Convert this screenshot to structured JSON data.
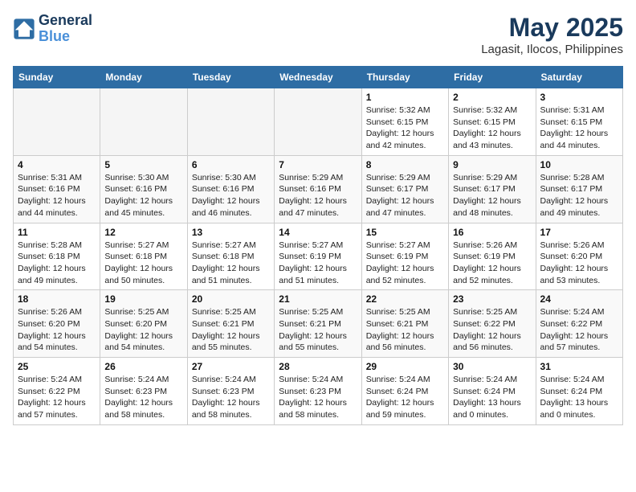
{
  "header": {
    "logo_line1": "General",
    "logo_line2": "Blue",
    "month_title": "May 2025",
    "location": "Lagasit, Ilocos, Philippines"
  },
  "weekdays": [
    "Sunday",
    "Monday",
    "Tuesday",
    "Wednesday",
    "Thursday",
    "Friday",
    "Saturday"
  ],
  "weeks": [
    [
      {
        "day": "",
        "info": ""
      },
      {
        "day": "",
        "info": ""
      },
      {
        "day": "",
        "info": ""
      },
      {
        "day": "",
        "info": ""
      },
      {
        "day": "1",
        "info": "Sunrise: 5:32 AM\nSunset: 6:15 PM\nDaylight: 12 hours\nand 42 minutes."
      },
      {
        "day": "2",
        "info": "Sunrise: 5:32 AM\nSunset: 6:15 PM\nDaylight: 12 hours\nand 43 minutes."
      },
      {
        "day": "3",
        "info": "Sunrise: 5:31 AM\nSunset: 6:15 PM\nDaylight: 12 hours\nand 44 minutes."
      }
    ],
    [
      {
        "day": "4",
        "info": "Sunrise: 5:31 AM\nSunset: 6:16 PM\nDaylight: 12 hours\nand 44 minutes."
      },
      {
        "day": "5",
        "info": "Sunrise: 5:30 AM\nSunset: 6:16 PM\nDaylight: 12 hours\nand 45 minutes."
      },
      {
        "day": "6",
        "info": "Sunrise: 5:30 AM\nSunset: 6:16 PM\nDaylight: 12 hours\nand 46 minutes."
      },
      {
        "day": "7",
        "info": "Sunrise: 5:29 AM\nSunset: 6:16 PM\nDaylight: 12 hours\nand 47 minutes."
      },
      {
        "day": "8",
        "info": "Sunrise: 5:29 AM\nSunset: 6:17 PM\nDaylight: 12 hours\nand 47 minutes."
      },
      {
        "day": "9",
        "info": "Sunrise: 5:29 AM\nSunset: 6:17 PM\nDaylight: 12 hours\nand 48 minutes."
      },
      {
        "day": "10",
        "info": "Sunrise: 5:28 AM\nSunset: 6:17 PM\nDaylight: 12 hours\nand 49 minutes."
      }
    ],
    [
      {
        "day": "11",
        "info": "Sunrise: 5:28 AM\nSunset: 6:18 PM\nDaylight: 12 hours\nand 49 minutes."
      },
      {
        "day": "12",
        "info": "Sunrise: 5:27 AM\nSunset: 6:18 PM\nDaylight: 12 hours\nand 50 minutes."
      },
      {
        "day": "13",
        "info": "Sunrise: 5:27 AM\nSunset: 6:18 PM\nDaylight: 12 hours\nand 51 minutes."
      },
      {
        "day": "14",
        "info": "Sunrise: 5:27 AM\nSunset: 6:19 PM\nDaylight: 12 hours\nand 51 minutes."
      },
      {
        "day": "15",
        "info": "Sunrise: 5:27 AM\nSunset: 6:19 PM\nDaylight: 12 hours\nand 52 minutes."
      },
      {
        "day": "16",
        "info": "Sunrise: 5:26 AM\nSunset: 6:19 PM\nDaylight: 12 hours\nand 52 minutes."
      },
      {
        "day": "17",
        "info": "Sunrise: 5:26 AM\nSunset: 6:20 PM\nDaylight: 12 hours\nand 53 minutes."
      }
    ],
    [
      {
        "day": "18",
        "info": "Sunrise: 5:26 AM\nSunset: 6:20 PM\nDaylight: 12 hours\nand 54 minutes."
      },
      {
        "day": "19",
        "info": "Sunrise: 5:25 AM\nSunset: 6:20 PM\nDaylight: 12 hours\nand 54 minutes."
      },
      {
        "day": "20",
        "info": "Sunrise: 5:25 AM\nSunset: 6:21 PM\nDaylight: 12 hours\nand 55 minutes."
      },
      {
        "day": "21",
        "info": "Sunrise: 5:25 AM\nSunset: 6:21 PM\nDaylight: 12 hours\nand 55 minutes."
      },
      {
        "day": "22",
        "info": "Sunrise: 5:25 AM\nSunset: 6:21 PM\nDaylight: 12 hours\nand 56 minutes."
      },
      {
        "day": "23",
        "info": "Sunrise: 5:25 AM\nSunset: 6:22 PM\nDaylight: 12 hours\nand 56 minutes."
      },
      {
        "day": "24",
        "info": "Sunrise: 5:24 AM\nSunset: 6:22 PM\nDaylight: 12 hours\nand 57 minutes."
      }
    ],
    [
      {
        "day": "25",
        "info": "Sunrise: 5:24 AM\nSunset: 6:22 PM\nDaylight: 12 hours\nand 57 minutes."
      },
      {
        "day": "26",
        "info": "Sunrise: 5:24 AM\nSunset: 6:23 PM\nDaylight: 12 hours\nand 58 minutes."
      },
      {
        "day": "27",
        "info": "Sunrise: 5:24 AM\nSunset: 6:23 PM\nDaylight: 12 hours\nand 58 minutes."
      },
      {
        "day": "28",
        "info": "Sunrise: 5:24 AM\nSunset: 6:23 PM\nDaylight: 12 hours\nand 58 minutes."
      },
      {
        "day": "29",
        "info": "Sunrise: 5:24 AM\nSunset: 6:24 PM\nDaylight: 12 hours\nand 59 minutes."
      },
      {
        "day": "30",
        "info": "Sunrise: 5:24 AM\nSunset: 6:24 PM\nDaylight: 13 hours\nand 0 minutes."
      },
      {
        "day": "31",
        "info": "Sunrise: 5:24 AM\nSunset: 6:24 PM\nDaylight: 13 hours\nand 0 minutes."
      }
    ]
  ]
}
